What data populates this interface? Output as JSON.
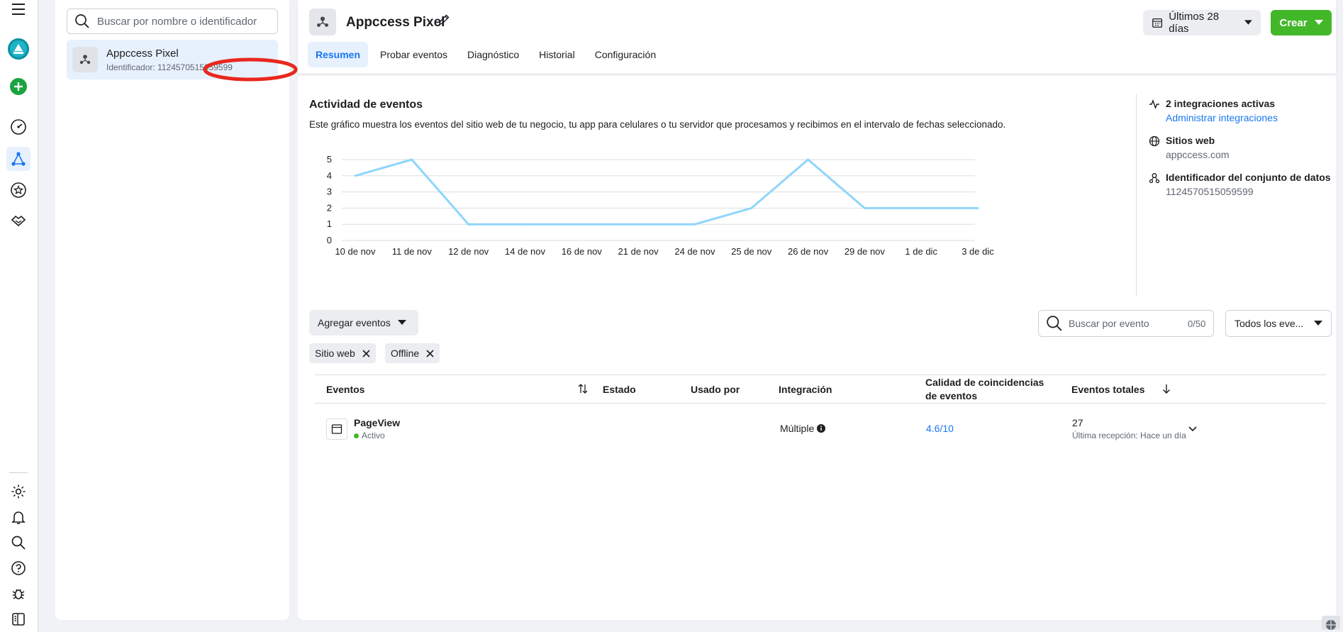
{
  "left_panel": {
    "search_placeholder": "Buscar por nombre o identificador",
    "pixel_item": {
      "name": "Appccess Pixel",
      "id_label": "Identificador:",
      "id_value": "1124570515059599"
    }
  },
  "header": {
    "title": "Appccess Pixel",
    "date_range": "Últimos 28 días",
    "create_label": "Crear"
  },
  "tabs": [
    {
      "label": "Resumen"
    },
    {
      "label": "Probar eventos"
    },
    {
      "label": "Diagnóstico"
    },
    {
      "label": "Historial"
    },
    {
      "label": "Configuración"
    }
  ],
  "activity": {
    "title": "Actividad de eventos",
    "description": "Este gráfico muestra los eventos del sitio web de tu negocio, tu app para celulares o tu servidor que procesamos y recibimos en el intervalo de fechas seleccionado."
  },
  "chart_data": {
    "type": "line",
    "categories": [
      "10 de nov",
      "11 de nov",
      "12 de nov",
      "14 de nov",
      "16 de nov",
      "21 de nov",
      "24 de nov",
      "25 de nov",
      "26 de nov",
      "29 de nov",
      "1 de dic",
      "3 de dic"
    ],
    "values": [
      4,
      5,
      1,
      1,
      1,
      1,
      1,
      2,
      5,
      2,
      2,
      2
    ],
    "yticks": [
      "0",
      "1",
      "2",
      "3",
      "4",
      "5"
    ],
    "ylim": [
      0,
      5
    ],
    "grid": true,
    "line_color": "#8ed6fb"
  },
  "side": {
    "integrations_title": "2 integraciones activas",
    "integrations_link": "Administrar integraciones",
    "websites_title": "Sitios web",
    "websites_value": "appccess.com",
    "dataset_title": "Identificador del conjunto de datos",
    "dataset_value": "1124570515059599"
  },
  "toolbar": {
    "add_events": "Agregar eventos",
    "search_placeholder": "Buscar por evento",
    "search_count": "0/50",
    "events_filter": "Todos los eve..."
  },
  "chips": [
    {
      "label": "Sitio web"
    },
    {
      "label": "Offline"
    }
  ],
  "table": {
    "columns": {
      "events": "Eventos",
      "status": "Estado",
      "used_by": "Usado por",
      "integration": "Integración",
      "quality": "Calidad de coincidencias de eventos",
      "total": "Eventos totales"
    },
    "rows": [
      {
        "name": "PageView",
        "state": "Activo",
        "integration": "Múltiple",
        "quality": "4.6/10",
        "total": "27",
        "last_received": "Última recepción: Hace un día"
      }
    ]
  },
  "colors": {
    "accent": "#1877f2",
    "create": "#42b72a",
    "active_dot": "#42b72a",
    "annotation": "#e8281e"
  }
}
